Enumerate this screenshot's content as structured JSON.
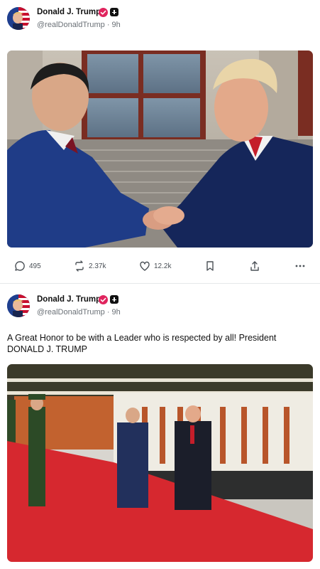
{
  "posts": [
    {
      "author": {
        "name": "Donald J. Trump",
        "handle": "@realDonaldTrump",
        "time": "9h"
      },
      "text": "",
      "image": {
        "description_icon": "photo-handshake"
      },
      "actions": {
        "replies": "495",
        "reposts": "2.37k",
        "likes": "12.2k"
      }
    },
    {
      "author": {
        "name": "Donald J. Trump",
        "handle": "@realDonaldTrump",
        "time": "9h"
      },
      "text": "A Great Honor to be with a Leader who is respected by all! President DONALD J. TRUMP",
      "image": {
        "description_icon": "photo-honor-guard"
      }
    }
  ],
  "separator": "·",
  "colors": {
    "verified": "#e0245e",
    "text_secondary": "#6b7177",
    "red_carpet": "#d6282f"
  }
}
